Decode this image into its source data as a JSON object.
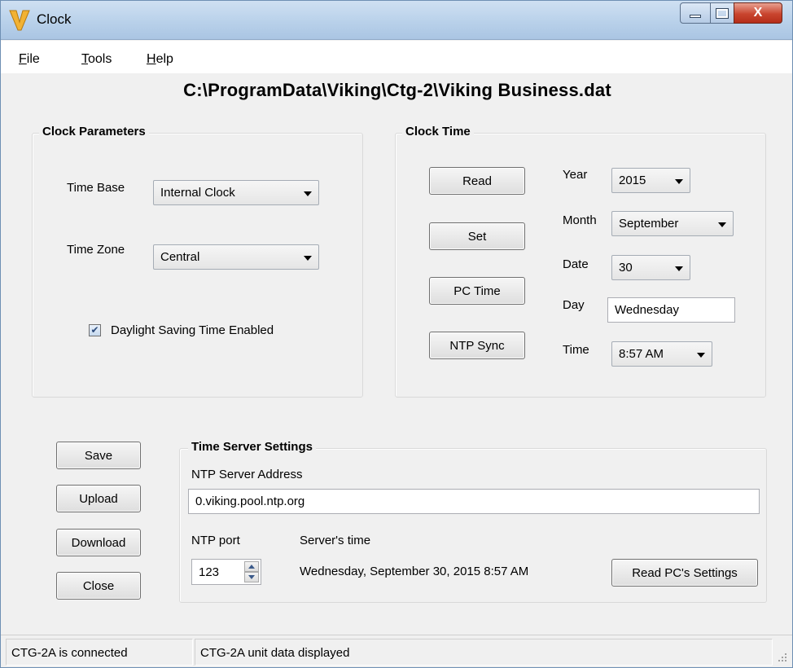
{
  "window": {
    "title": "Clock",
    "icon": "viking-v-logo-icon",
    "close_glyph": "X"
  },
  "menu": {
    "items": [
      {
        "key": "F",
        "rest": "ile"
      },
      {
        "key": "T",
        "rest": "ools"
      },
      {
        "key": "H",
        "rest": "elp"
      }
    ]
  },
  "file_path": "C:\\ProgramData\\Viking\\Ctg-2\\Viking Business.dat",
  "clock_parameters": {
    "title": "Clock Parameters",
    "time_base_label": "Time Base",
    "time_base_value": "Internal Clock",
    "time_zone_label": "Time Zone",
    "time_zone_value": "Central",
    "dst_label": "Daylight Saving Time Enabled",
    "dst_checked": true
  },
  "clock_time": {
    "title": "Clock Time",
    "buttons": {
      "read": "Read",
      "set": "Set",
      "pc_time": "PC Time",
      "ntp_sync": "NTP Sync"
    },
    "year_label": "Year",
    "year_value": "2015",
    "month_label": "Month",
    "month_value": "September",
    "date_label": "Date",
    "date_value": "30",
    "day_label": "Day",
    "day_value": "Wednesday",
    "time_label": "Time",
    "time_value": "8:57 AM"
  },
  "actions": {
    "save": "Save",
    "upload": "Upload",
    "download": "Download",
    "close": "Close"
  },
  "time_server": {
    "title": "Time Server Settings",
    "address_label": "NTP Server Address",
    "address_value": "0.viking.pool.ntp.org",
    "port_label": "NTP port",
    "port_value": "123",
    "server_time_label": "Server's time",
    "server_time_value": "Wednesday, September 30, 2015 8:57 AM",
    "read_pc_button": "Read PC's Settings"
  },
  "status": {
    "left": "CTG-2A is connected",
    "right": "CTG-2A unit data displayed"
  },
  "colors": {
    "title_bar": "#b9d1ea",
    "close_button": "#c9452f",
    "window_bg": "#f0f0f0"
  }
}
